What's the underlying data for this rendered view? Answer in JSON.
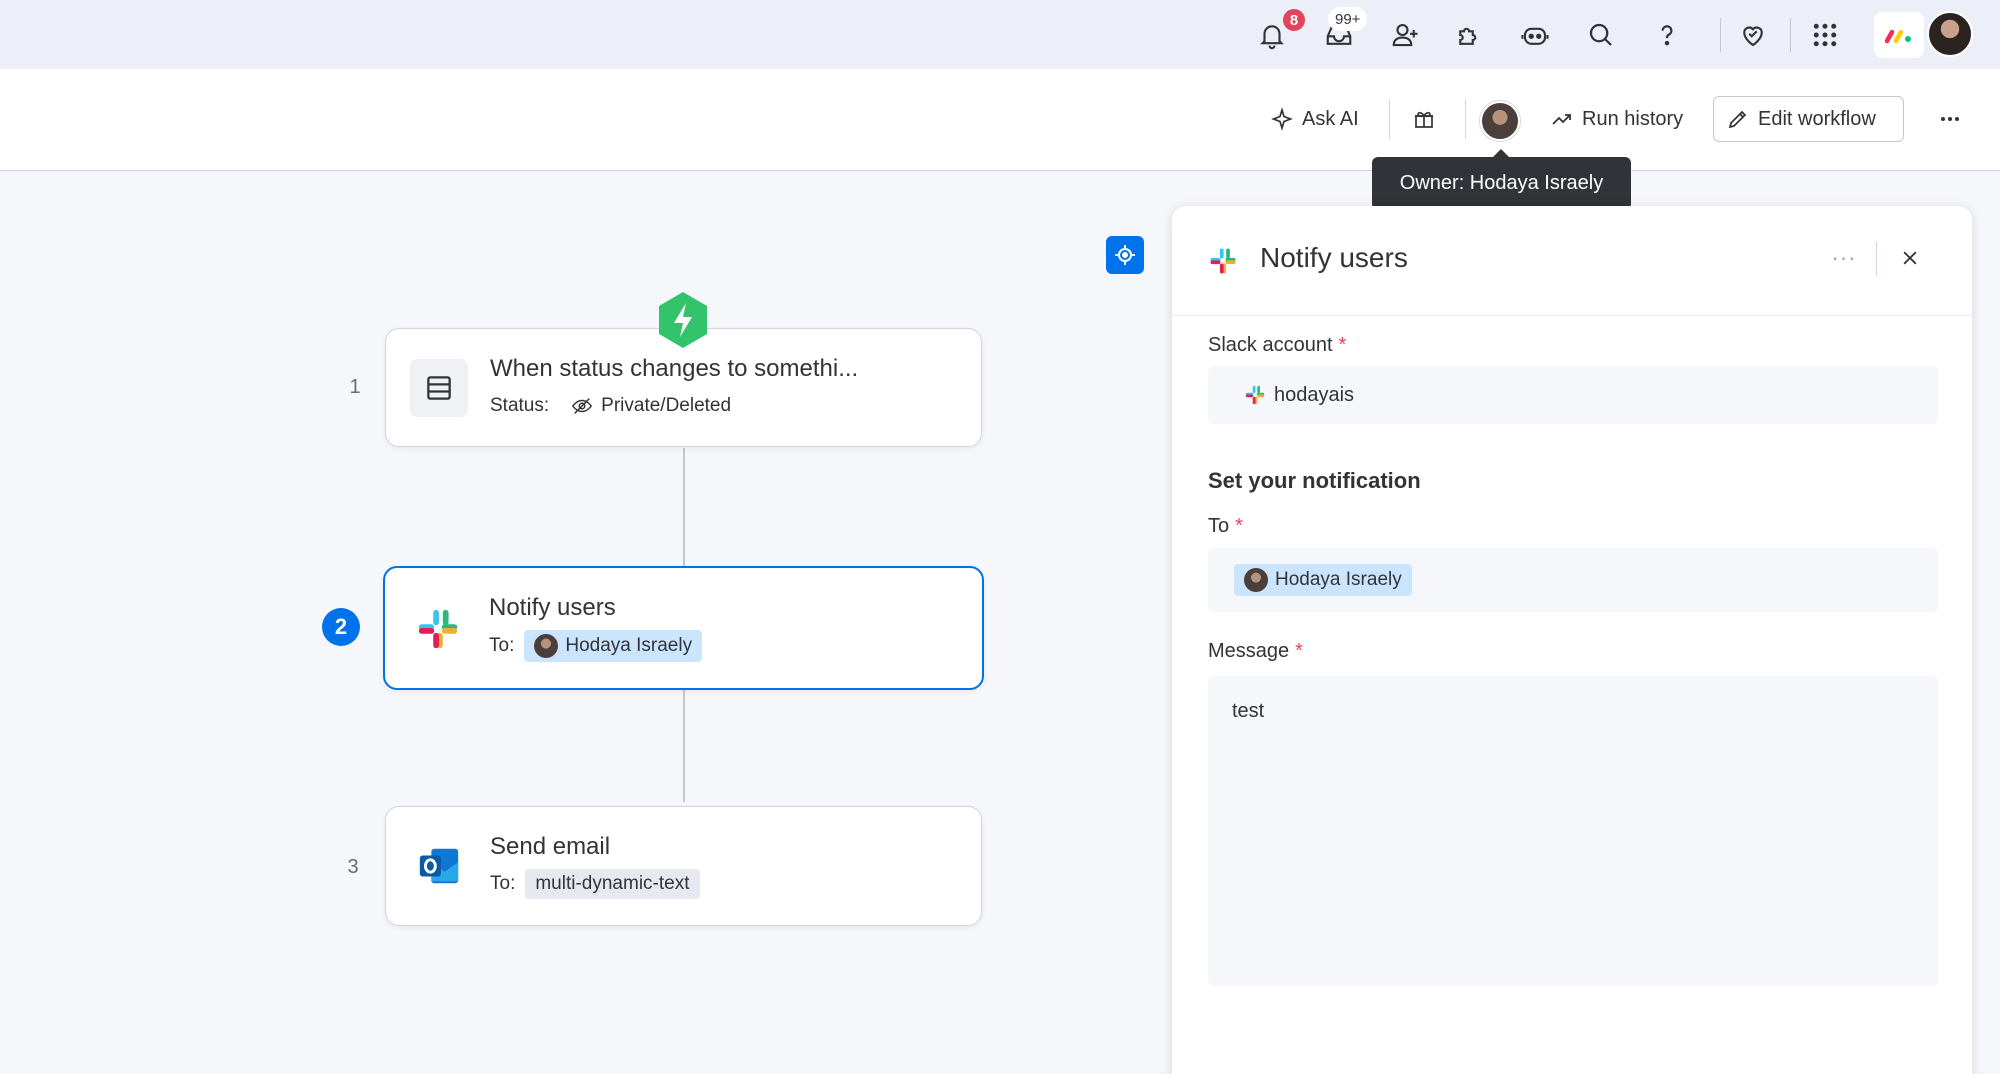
{
  "topbar": {
    "notifications_badge": "8",
    "inbox_badge": "99+",
    "icons": [
      "bell-icon",
      "inbox-icon",
      "invite-user-icon",
      "integrations-icon",
      "ai-bot-icon",
      "search-icon",
      "help-icon",
      "heart-icon",
      "apps-grid-icon"
    ]
  },
  "header": {
    "ask_ai_label": "Ask AI",
    "run_history_label": "Run history",
    "edit_workflow_label": "Edit workflow",
    "owner_tooltip": "Owner: Hodaya Israely"
  },
  "workflow": {
    "steps": [
      {
        "number": "1",
        "title": "When status changes to somethi...",
        "sub_label": "Status:",
        "sub_value": "Private/Deleted",
        "icon": "board-table-icon"
      },
      {
        "number": "2",
        "title": "Notify users",
        "sub_label": "To:",
        "sub_value": "Hodaya Israely",
        "icon": "slack-icon"
      },
      {
        "number": "3",
        "title": "Send email",
        "sub_label": "To:",
        "sub_value": "multi-dynamic-text",
        "icon": "outlook-icon"
      }
    ]
  },
  "panel": {
    "title": "Notify users",
    "slack_account_label": "Slack account",
    "slack_account_value": "hodayais",
    "section_title": "Set your notification",
    "to_label": "To",
    "to_value": "Hodaya Israely",
    "message_label": "Message",
    "message_value": "test",
    "required_mark": "*"
  },
  "colors": {
    "primary": "#0073ea",
    "required": "#e2445c",
    "trigger_green": "#33c36a",
    "chip_blue": "#cce5ff"
  }
}
